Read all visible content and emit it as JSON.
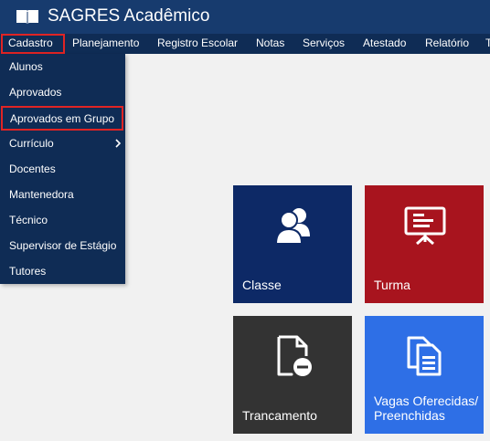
{
  "header": {
    "title": "SAGRES Acadêmico"
  },
  "menu": {
    "items": [
      {
        "label": "Cadastro"
      },
      {
        "label": "Planejamento"
      },
      {
        "label": "Registro Escolar"
      },
      {
        "label": "Notas"
      },
      {
        "label": "Serviços"
      },
      {
        "label": "Atestado"
      },
      {
        "label": "Relatório"
      },
      {
        "label": "T"
      }
    ]
  },
  "dropdown": {
    "items": [
      {
        "label": "Alunos"
      },
      {
        "label": "Aprovados"
      },
      {
        "label": "Aprovados em Grupo"
      },
      {
        "label": "Currículo"
      },
      {
        "label": "Docentes"
      },
      {
        "label": "Mantenedora"
      },
      {
        "label": "Técnico"
      },
      {
        "label": "Supervisor de Estágio"
      },
      {
        "label": "Tutores"
      }
    ]
  },
  "tiles": [
    {
      "label": "Classe",
      "color": "#0d2966"
    },
    {
      "label": "Turma",
      "color": "#a8141e"
    },
    {
      "label": "Trancamento",
      "color": "#333333"
    },
    {
      "label_line1": "Vagas Oferecidas/",
      "label_line2": "Preenchidas",
      "color": "#2e6fe6"
    }
  ],
  "colors": {
    "header_bg": "#173b6e",
    "menu_bg": "#0f2c55",
    "highlight": "#e02424",
    "page_bg": "#f1f1f1"
  }
}
